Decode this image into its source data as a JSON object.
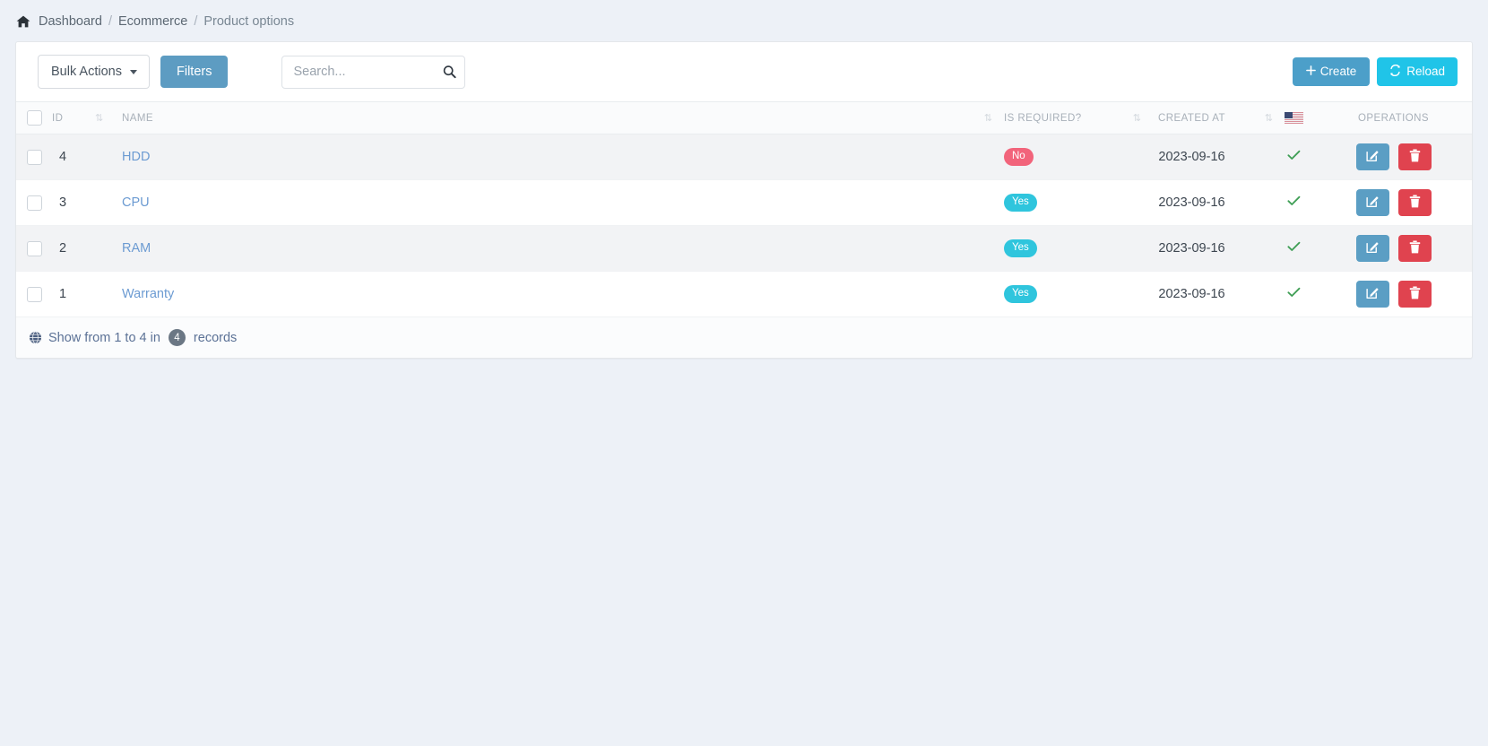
{
  "breadcrumb": {
    "home_icon": "home-icon",
    "items": [
      {
        "label": "Dashboard",
        "sep": "/"
      },
      {
        "label": "Ecommerce",
        "sep": "/"
      },
      {
        "label": "Product options",
        "sep": ""
      }
    ]
  },
  "toolbar": {
    "bulk_actions_label": "Bulk Actions",
    "bulk_actions_icon": "caret-down-icon",
    "filters_label": "Filters",
    "search_placeholder": "Search...",
    "search_value": "",
    "search_icon": "search-icon",
    "create_label": "Create",
    "create_icon": "plus-icon",
    "reload_label": "Reload",
    "reload_icon": "refresh-icon"
  },
  "table": {
    "select_all_checkbox": "",
    "columns": {
      "id": "ID",
      "name": "NAME",
      "is_required": "IS REQUIRED?",
      "created_at": "CREATED AT",
      "flag": "us-flag-icon",
      "operations": "OPERATIONS"
    },
    "sort_icon": "⇅",
    "rows": [
      {
        "id": "4",
        "name": "HDD",
        "is_required": "No",
        "is_required_state": "no",
        "created_at": "2023-09-16",
        "active": true,
        "edit_icon": "edit-icon",
        "delete_icon": "trash-icon"
      },
      {
        "id": "3",
        "name": "CPU",
        "is_required": "Yes",
        "is_required_state": "yes",
        "created_at": "2023-09-16",
        "active": true,
        "edit_icon": "edit-icon",
        "delete_icon": "trash-icon"
      },
      {
        "id": "2",
        "name": "RAM",
        "is_required": "Yes",
        "is_required_state": "yes",
        "created_at": "2023-09-16",
        "active": true,
        "edit_icon": "edit-icon",
        "delete_icon": "trash-icon"
      },
      {
        "id": "1",
        "name": "Warranty",
        "is_required": "Yes",
        "is_required_state": "yes",
        "created_at": "2023-09-16",
        "active": true,
        "edit_icon": "edit-icon",
        "delete_icon": "trash-icon"
      }
    ]
  },
  "footer": {
    "globe_icon": "globe-icon",
    "text_before": "Show from 1 to 4 in",
    "record_count": "4",
    "text_after": "records"
  },
  "colors": {
    "page_bg": "#edf1f7",
    "filters_btn": "#5d9cc2",
    "create_btn": "#4c9fc9",
    "reload_btn": "#20c4e8",
    "badge_yes": "#2fc5dd",
    "badge_no": "#f2647b",
    "edit_btn": "#5b9ec4",
    "delete_btn": "#e0434f",
    "check_green": "#3f9e55",
    "link_blue": "#6c9bd2"
  }
}
